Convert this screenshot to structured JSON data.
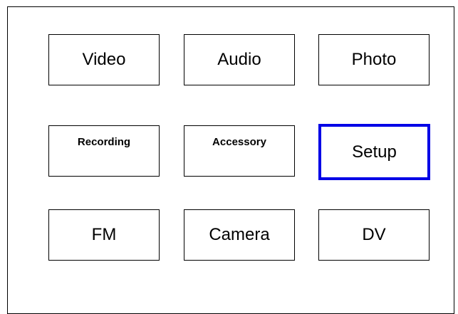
{
  "menu": {
    "items": [
      {
        "label": "Video"
      },
      {
        "label": "Audio"
      },
      {
        "label": "Photo"
      },
      {
        "label": "Recording"
      },
      {
        "label": "Accessory"
      },
      {
        "label": "Setup",
        "selected": true
      },
      {
        "label": "FM"
      },
      {
        "label": "Camera"
      },
      {
        "label": "DV"
      }
    ],
    "selection_color": "#0000e6"
  }
}
